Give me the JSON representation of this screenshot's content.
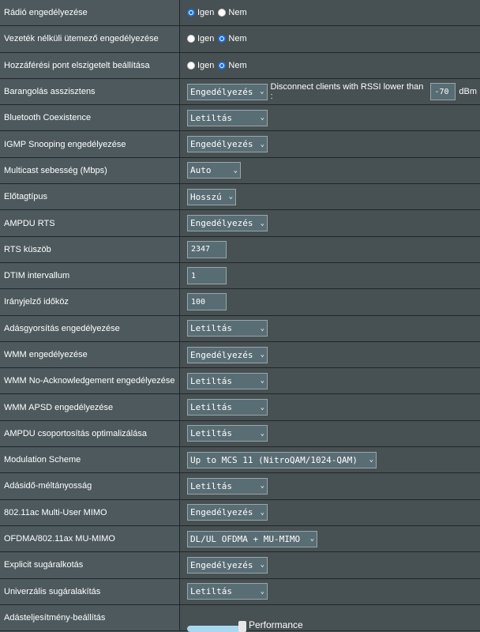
{
  "yes_label": "Igen",
  "no_label": "Nem",
  "chevron": "⌄",
  "accent_color": "#1e6fd9",
  "rows": [
    {
      "label": "Rádió engedélyezése",
      "type": "radio",
      "selected": "Igen"
    },
    {
      "label": "Vezeték nélküli ütemező engedélyezése",
      "type": "radio",
      "selected": "Nem"
    },
    {
      "label": "Hozzáférési pont elszigetelt beállítása",
      "type": "radio",
      "selected": "Nem"
    },
    {
      "label": "Barangolás asszisztens",
      "type": "roaming",
      "value": "Engedélyezés",
      "rssi_text": "Disconnect clients with RSSI lower than :",
      "rssi_value": "-70",
      "rssi_unit": "dBm"
    },
    {
      "label": "Bluetooth Coexistence",
      "type": "select",
      "value": "Letiltás"
    },
    {
      "label": "IGMP Snooping engedélyezése",
      "type": "select",
      "value": "Engedélyezés"
    },
    {
      "label": "Multicast sebesség (Mbps)",
      "type": "select",
      "value": "Auto"
    },
    {
      "label": "Előtagtípus",
      "type": "select",
      "value": "Hosszú"
    },
    {
      "label": "AMPDU RTS",
      "type": "select",
      "value": "Engedélyezés"
    },
    {
      "label": "RTS küszöb",
      "type": "input",
      "value": "2347"
    },
    {
      "label": "DTIM intervallum",
      "type": "input",
      "value": "1"
    },
    {
      "label": "Irányjelző időköz",
      "type": "input",
      "value": "100"
    },
    {
      "label": "Adásgyorsítás engedélyezése",
      "type": "select",
      "value": "Letiltás"
    },
    {
      "label": "WMM engedélyezése",
      "type": "select",
      "value": "Engedélyezés"
    },
    {
      "label": "WMM No-Acknowledgement engedélyezése",
      "type": "select",
      "value": "Letiltás"
    },
    {
      "label": "WMM APSD engedélyezése",
      "type": "select",
      "value": "Letiltás"
    },
    {
      "label": "AMPDU csoportosítás optimalizálása",
      "type": "select",
      "value": "Letiltás"
    },
    {
      "label": "Modulation Scheme",
      "type": "select",
      "value": "Up to MCS 11 (NitroQAM/1024-QAM)"
    },
    {
      "label": "Adásidő-méltányosság",
      "type": "select",
      "value": "Letiltás"
    },
    {
      "label": "802.11ac Multi-User MIMO",
      "type": "select",
      "value": "Engedélyezés"
    },
    {
      "label": "OFDMA/802.11ax MU-MIMO",
      "type": "select",
      "value": "DL/UL OFDMA + MU-MIMO"
    },
    {
      "label": "Explicit sugáralkotás",
      "type": "select",
      "value": "Engedélyezés"
    },
    {
      "label": "Univerzális sugáralakítás",
      "type": "select",
      "value": "Letiltás"
    },
    {
      "label": "Adásteljesítmény-beállítás",
      "type": "slider",
      "value": "Performance",
      "level": 1.0
    }
  ]
}
